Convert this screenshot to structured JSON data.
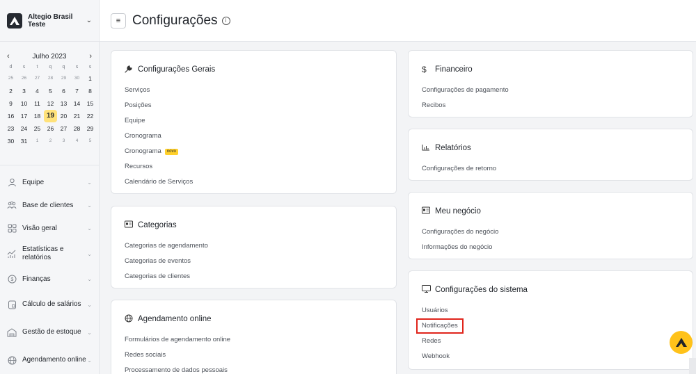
{
  "company": {
    "name": "Altegio Brasil Teste"
  },
  "calendar": {
    "month": "Julho 2023",
    "weekdays": [
      "d",
      "s",
      "t",
      "q",
      "q",
      "s",
      "s"
    ],
    "weeks": [
      [
        "25",
        "26",
        "27",
        "28",
        "29",
        "30",
        "1"
      ],
      [
        "2",
        "3",
        "4",
        "5",
        "6",
        "7",
        "8"
      ],
      [
        "9",
        "10",
        "11",
        "12",
        "13",
        "14",
        "15"
      ],
      [
        "16",
        "17",
        "18",
        "19",
        "20",
        "21",
        "22"
      ],
      [
        "23",
        "24",
        "25",
        "26",
        "27",
        "28",
        "29"
      ],
      [
        "30",
        "31",
        "1",
        "2",
        "3",
        "4",
        "5"
      ]
    ],
    "today": "19"
  },
  "nav": {
    "items": [
      {
        "label": "Equipe",
        "icon": "person-icon"
      },
      {
        "label": "Base de clientes",
        "icon": "clients-icon"
      },
      {
        "label": "Visão geral",
        "icon": "grid-icon"
      },
      {
        "label": "Estatísticas e relatórios",
        "icon": "stats-icon"
      },
      {
        "label": "Finanças",
        "icon": "dollar-icon"
      },
      {
        "label": "Cálculo de salários",
        "icon": "calculator-icon"
      },
      {
        "label": "Gestão de estoque",
        "icon": "warehouse-icon"
      },
      {
        "label": "Agendamento online",
        "icon": "globe-icon"
      }
    ]
  },
  "header": {
    "title": "Configurações"
  },
  "cards": {
    "gerais": {
      "title": "Configurações Gerais",
      "icon": "wrench-icon",
      "links": [
        "Serviços",
        "Posições",
        "Equipe",
        "Cronograma",
        "Cronograma",
        "Recursos",
        "Calendário de Serviços"
      ],
      "badge": "novo"
    },
    "categorias": {
      "title": "Categorias",
      "icon": "id-card-icon",
      "links": [
        "Categorias de agendamento",
        "Categorias de eventos",
        "Categorias de clientes"
      ]
    },
    "agendamento": {
      "title": "Agendamento online",
      "icon": "globe-icon",
      "links": [
        "Formulários de agendamento online",
        "Redes sociais",
        "Processamento de dados pessoais"
      ]
    },
    "financeiro": {
      "title": "Financeiro",
      "icon": "dollar-icon",
      "links": [
        "Configurações de pagamento",
        "Recibos"
      ]
    },
    "relatorios": {
      "title": "Relatórios",
      "icon": "bar-chart-icon",
      "links": [
        "Configurações de retorno"
      ]
    },
    "negocio": {
      "title": "Meu negócio",
      "icon": "id-card-icon",
      "links": [
        "Configurações do negócio",
        "Informações do negócio"
      ]
    },
    "sistema": {
      "title": "Configurações do sistema",
      "icon": "monitor-icon",
      "links": [
        "Usuários",
        "Notificações",
        "Redes",
        "Webhook"
      ]
    }
  },
  "colors": {
    "accent": "#ffc21a",
    "highlight": "#e0241b",
    "today": "#ffe27a"
  }
}
